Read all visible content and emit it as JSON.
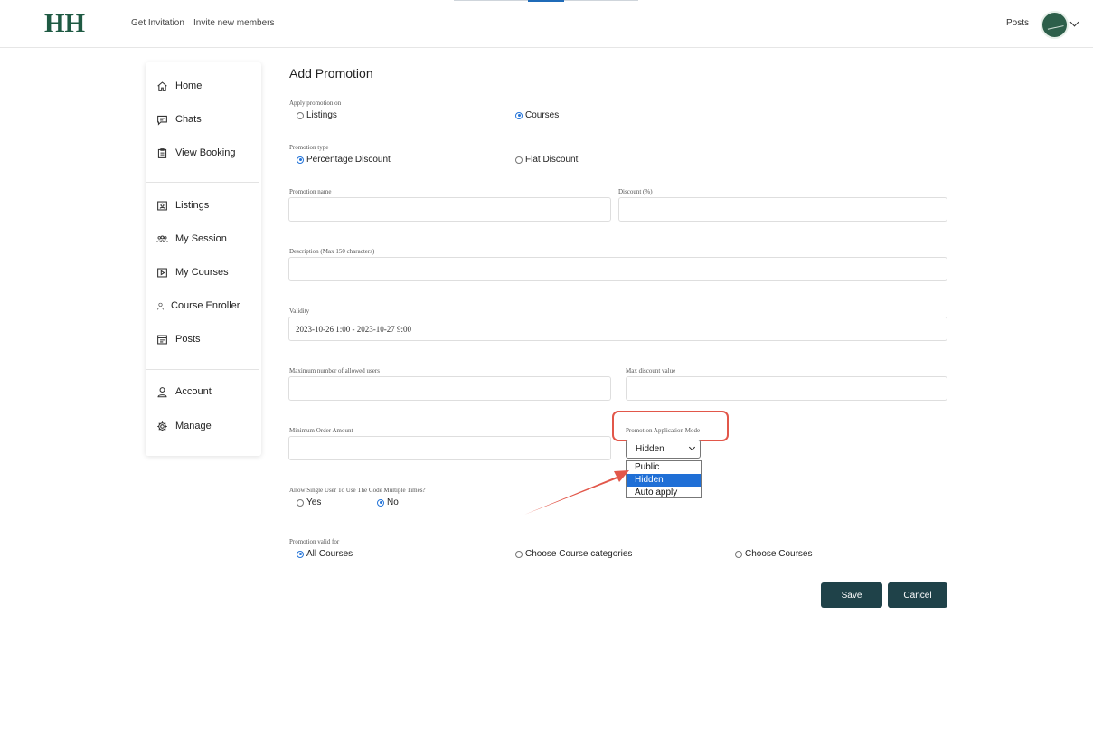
{
  "header": {
    "logo": "HH",
    "links": [
      "Get Invitation",
      "Invite new members"
    ],
    "posts_label": "Posts"
  },
  "sidebar": {
    "items": [
      {
        "label": "Home",
        "icon": "home-icon"
      },
      {
        "label": "Chats",
        "icon": "chat-icon"
      },
      {
        "label": "View Booking",
        "icon": "clipboard-icon"
      },
      {
        "label": "Listings",
        "icon": "id-card-icon"
      },
      {
        "label": "My Session",
        "icon": "group-icon"
      },
      {
        "label": "My Courses",
        "icon": "play-icon"
      },
      {
        "label": "Course Enroller",
        "icon": "person-icon"
      },
      {
        "label": "Posts",
        "icon": "posts-icon"
      },
      {
        "label": "Account",
        "icon": "user-icon"
      },
      {
        "label": "Manage",
        "icon": "gear-icon"
      }
    ]
  },
  "form": {
    "title": "Add Promotion",
    "apply_on": {
      "label": "Apply promotion on",
      "options": [
        "Listings",
        "Courses"
      ],
      "selected": "Courses"
    },
    "promotion_type": {
      "label": "Promotion type",
      "options": [
        "Percentage Discount",
        "Flat Discount"
      ],
      "selected": "Percentage Discount"
    },
    "promotion_name": {
      "label": "Promotion name",
      "value": ""
    },
    "discount": {
      "label": "Discount (%)",
      "value": ""
    },
    "description": {
      "label": "Description (Max 150 characters)",
      "value": ""
    },
    "validity": {
      "label": "Validity",
      "value": "2023-10-26 1:00 - 2023-10-27 9:00"
    },
    "max_users": {
      "label": "Maximum number of allowed users",
      "value": ""
    },
    "max_discount": {
      "label": "Max discount value",
      "value": ""
    },
    "min_order": {
      "label": "Minimum Order Amount",
      "value": ""
    },
    "application_mode": {
      "label": "Promotion Application Mode",
      "value": "Hidden",
      "options": [
        "Public",
        "Hidden",
        "Auto apply"
      ],
      "highlighted": "Hidden"
    },
    "multiple_use": {
      "label": "Allow Single User To Use The Code Multiple Times?",
      "options": [
        "Yes",
        "No"
      ],
      "selected": "No"
    },
    "valid_for": {
      "label": "Promotion valid for",
      "options": [
        "All Courses",
        "Choose Course categories",
        "Choose Courses"
      ],
      "selected": "All Courses"
    },
    "save_label": "Save",
    "cancel_label": "Cancel"
  },
  "colors": {
    "brand": "#1f5a43",
    "button": "#1f4249",
    "radio_selected": "#2474d8",
    "dropdown_highlight": "#1f6fd6",
    "annotation": "#e2574a"
  }
}
